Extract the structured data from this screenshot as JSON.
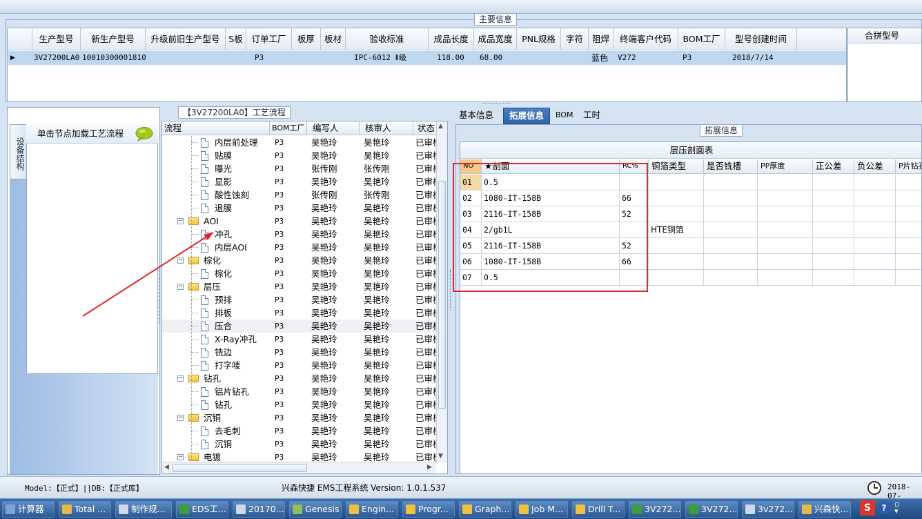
{
  "top_group_title": "主要信息",
  "main_grid": {
    "headers": [
      "生产型号",
      "新生产型号",
      "升级前旧生产型号",
      "S板",
      "订单工厂",
      "板厚",
      "板材",
      "验收标准",
      "成品长度",
      "成品宽度",
      "PNL规格",
      "字符",
      "阻焊",
      "终端客户代码",
      "BOM工厂",
      "型号创建时间"
    ],
    "row": {
      "c0": "3V27200LA0",
      "c1": "10010300001810",
      "c2": "",
      "c3": "",
      "c4": "P3",
      "c5": "",
      "c6": "",
      "c7": "IPC-6012 Ⅱ级",
      "c8": "118.00",
      "c9": "68.00",
      "c10": "",
      "c11": "",
      "c12": "蓝色",
      "c13": "V272",
      "c14": "P3",
      "c15": "2018/7/14"
    }
  },
  "sub_grid_header": "合拼型号",
  "left_panel": {
    "vertical_tab": "设备结构",
    "click_hint": "单击节点加载工艺流程"
  },
  "process_title": "【3V27200LA0】工艺流程",
  "tree": {
    "headers": [
      "流程",
      "BOM工厂",
      "编写人",
      "核审人",
      "状态"
    ],
    "rows": [
      {
        "name": "内层前处理",
        "bom": "P3",
        "writer": "吴艳玲",
        "reviewer": "吴艳玲",
        "status": "已审核"
      },
      {
        "name": "贴膜",
        "bom": "P3",
        "writer": "吴艳玲",
        "reviewer": "吴艳玲",
        "status": "已审核"
      },
      {
        "name": "曝光",
        "bom": "P3",
        "writer": "张传刚",
        "reviewer": "张传刚",
        "status": "已审核"
      },
      {
        "name": "显影",
        "bom": "P3",
        "writer": "吴艳玲",
        "reviewer": "吴艳玲",
        "status": "已审核"
      },
      {
        "name": "酸性蚀刻",
        "bom": "P3",
        "writer": "张传刚",
        "reviewer": "张传刚",
        "status": "已审核"
      },
      {
        "name": "退膜",
        "bom": "P3",
        "writer": "吴艳玲",
        "reviewer": "吴艳玲",
        "status": "已审核"
      },
      {
        "name": "AOI",
        "bom": "P3",
        "writer": "吴艳玲",
        "reviewer": "吴艳玲",
        "status": "已审核"
      },
      {
        "name": "冲孔",
        "bom": "P3",
        "writer": "吴艳玲",
        "reviewer": "吴艳玲",
        "status": "已审核"
      },
      {
        "name": "内层AOI",
        "bom": "P3",
        "writer": "吴艳玲",
        "reviewer": "吴艳玲",
        "status": "已审核"
      },
      {
        "name": "棕化",
        "bom": "P3",
        "writer": "吴艳玲",
        "reviewer": "吴艳玲",
        "status": "已审核"
      },
      {
        "name": "棕化",
        "bom": "P3",
        "writer": "吴艳玲",
        "reviewer": "吴艳玲",
        "status": "已审核"
      },
      {
        "name": "层压",
        "bom": "P3",
        "writer": "吴艳玲",
        "reviewer": "吴艳玲",
        "status": "已审核"
      },
      {
        "name": "预排",
        "bom": "P3",
        "writer": "吴艳玲",
        "reviewer": "吴艳玲",
        "status": "已审核"
      },
      {
        "name": "排板",
        "bom": "P3",
        "writer": "吴艳玲",
        "reviewer": "吴艳玲",
        "status": "已审核"
      },
      {
        "name": "压合",
        "bom": "P3",
        "writer": "吴艳玲",
        "reviewer": "吴艳玲",
        "status": "已审核"
      },
      {
        "name": "X-Ray冲孔",
        "bom": "P3",
        "writer": "吴艳玲",
        "reviewer": "吴艳玲",
        "status": "已审核"
      },
      {
        "name": "铣边",
        "bom": "P3",
        "writer": "吴艳玲",
        "reviewer": "吴艳玲",
        "status": "已审核"
      },
      {
        "name": "打字唛",
        "bom": "P3",
        "writer": "吴艳玲",
        "reviewer": "吴艳玲",
        "status": "已审核"
      },
      {
        "name": "钻孔",
        "bom": "P3",
        "writer": "吴艳玲",
        "reviewer": "吴艳玲",
        "status": "已审核"
      },
      {
        "name": "铝片钻孔",
        "bom": "P3",
        "writer": "吴艳玲",
        "reviewer": "吴艳玲",
        "status": "已审核"
      },
      {
        "name": "钻孔",
        "bom": "P3",
        "writer": "吴艳玲",
        "reviewer": "吴艳玲",
        "status": "已审核"
      },
      {
        "name": "沉铜",
        "bom": "P3",
        "writer": "吴艳玲",
        "reviewer": "吴艳玲",
        "status": "已审核"
      },
      {
        "name": "去毛刺",
        "bom": "P3",
        "writer": "吴艳玲",
        "reviewer": "吴艳玲",
        "status": "已审核"
      },
      {
        "name": "沉铜",
        "bom": "P3",
        "writer": "吴艳玲",
        "reviewer": "吴艳玲",
        "status": "已审核"
      },
      {
        "name": "电镀",
        "bom": "P3",
        "writer": "吴艳玲",
        "reviewer": "吴艳玲",
        "status": "已审核"
      }
    ]
  },
  "right_tabs": [
    "基本信息",
    "拓展信息",
    "BOM",
    "工时"
  ],
  "ext_group_title": "拓展信息",
  "laminate": {
    "caption": "层压剖面表",
    "headers": [
      "NO",
      "★剖面",
      "RC%",
      "铜箔类型",
      "是否铣槽",
      "PP厚度",
      "正公差",
      "负公差",
      "P片钻孔"
    ],
    "rows": [
      {
        "no": "01",
        "profile": "0.5",
        "rc": "",
        "foil": ""
      },
      {
        "no": "02",
        "profile": "1080-IT-158B",
        "rc": "66",
        "foil": ""
      },
      {
        "no": "03",
        "profile": "2116-IT-158B",
        "rc": "52",
        "foil": ""
      },
      {
        "no": "04",
        "profile": "2/gb1L",
        "rc": "",
        "foil": "HTE铜箔"
      },
      {
        "no": "05",
        "profile": "2116-IT-158B",
        "rc": "52",
        "foil": ""
      },
      {
        "no": "06",
        "profile": "1080-IT-158B",
        "rc": "66",
        "foil": ""
      },
      {
        "no": "07",
        "profile": "0.5",
        "rc": "",
        "foil": ""
      }
    ]
  },
  "status": {
    "model": "Model:【正式】||DB:【正式库】",
    "system": "兴森快捷 EMS工程系统 Version: 1.0.1.537",
    "date": "2018-07-"
  },
  "taskbar": [
    {
      "label": "计算器",
      "color": "#7aa4d8"
    },
    {
      "label": "Total ...",
      "color": "#e6b84a"
    },
    {
      "label": "制作规...",
      "color": "#cfd8e6"
    },
    {
      "label": "EDS工...",
      "color": "#3f9c3a"
    },
    {
      "label": "20170...",
      "color": "#cfd8e6"
    },
    {
      "label": "Genesis",
      "color": "#8fbf5a"
    },
    {
      "label": "Engin...",
      "color": "#f0c040"
    },
    {
      "label": "Progr...",
      "color": "#f0c040"
    },
    {
      "label": "Graph...",
      "color": "#f0c040"
    },
    {
      "label": "Job M...",
      "color": "#f0c040"
    },
    {
      "label": "Drill T...",
      "color": "#f0c040"
    },
    {
      "label": "3V272...",
      "color": "#3f9c3a"
    },
    {
      "label": "3V272...",
      "color": "#3f9c3a"
    },
    {
      "label": "3v272...",
      "color": "#cfd8e6"
    },
    {
      "label": "兴森快...",
      "color": "#e6b84a"
    }
  ],
  "tray_input": "S"
}
